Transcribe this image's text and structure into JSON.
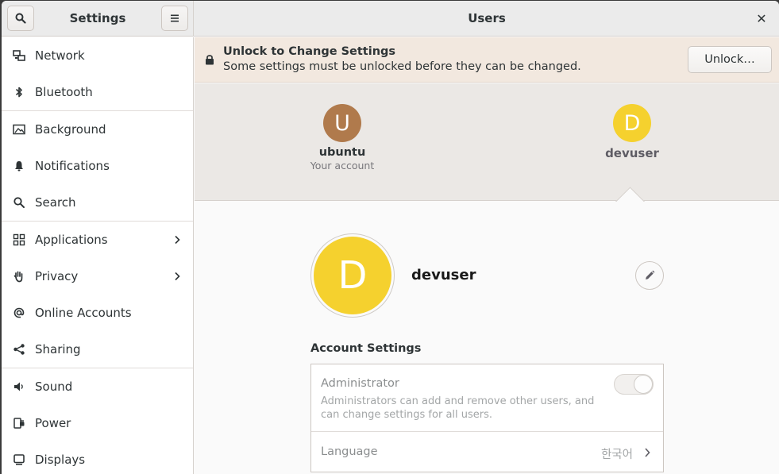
{
  "header": {
    "sidebar_title": "Settings",
    "main_title": "Users",
    "close_glyph": "✕"
  },
  "sidebar": {
    "items": [
      {
        "label": "Network",
        "icon": "network-icon"
      },
      {
        "label": "Bluetooth",
        "icon": "bluetooth-icon"
      },
      {
        "label": "Background",
        "icon": "background-icon"
      },
      {
        "label": "Notifications",
        "icon": "bell-icon"
      },
      {
        "label": "Search",
        "icon": "search-icon"
      },
      {
        "label": "Applications",
        "icon": "apps-grid-icon"
      },
      {
        "label": "Privacy",
        "icon": "hand-icon"
      },
      {
        "label": "Online Accounts",
        "icon": "at-sign-icon"
      },
      {
        "label": "Sharing",
        "icon": "share-icon"
      },
      {
        "label": "Sound",
        "icon": "speaker-icon"
      },
      {
        "label": "Power",
        "icon": "power-plug-icon"
      },
      {
        "label": "Displays",
        "icon": "display-icon"
      }
    ]
  },
  "infobar": {
    "title": "Unlock to Change Settings",
    "subtitle": "Some settings must be unlocked before they can be changed.",
    "unlock_label": "Unlock…"
  },
  "users": [
    {
      "initial": "U",
      "name": "ubuntu",
      "subtitle": "Your account",
      "color": "#b07a4c"
    },
    {
      "initial": "D",
      "name": "devuser",
      "subtitle": "",
      "color": "#f5d12e"
    }
  ],
  "selected_user": {
    "initial": "D",
    "name": "devuser"
  },
  "account_settings": {
    "title": "Account Settings",
    "administrator": {
      "title": "Administrator",
      "description": "Administrators can add and remove other users, and can change settings for all users.",
      "enabled": false
    },
    "language": {
      "title": "Language",
      "value": "한국어"
    }
  },
  "colors": {
    "accent_yellow": "#f5d12e",
    "accent_brown": "#b07a4c",
    "infobar_bg": "#f2e8df"
  }
}
